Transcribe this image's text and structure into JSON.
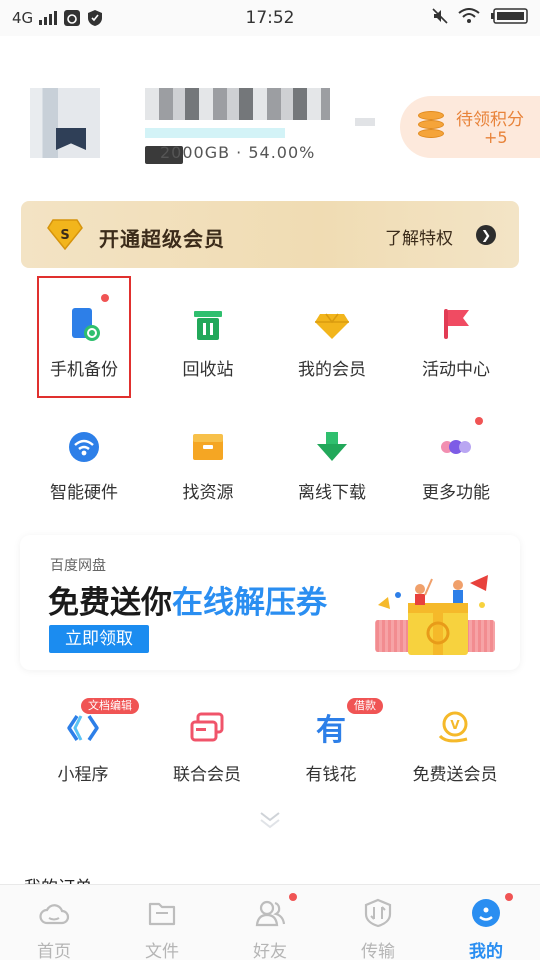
{
  "status_bar": {
    "network": "4G",
    "time": "17:52"
  },
  "profile": {
    "storage_text": "2000GB · 54.00%",
    "points_label": "待领积分",
    "points_value": "+5"
  },
  "vip_banner": {
    "title": "开通超级会员",
    "link": "了解特权"
  },
  "grid": [
    {
      "label": "手机备份",
      "icon": "phone-backup-icon",
      "dot": true
    },
    {
      "label": "回收站",
      "icon": "trash-bin-icon",
      "dot": false
    },
    {
      "label": "我的会员",
      "icon": "diamond-icon",
      "dot": false
    },
    {
      "label": "活动中心",
      "icon": "flag-icon",
      "dot": false
    },
    {
      "label": "智能硬件",
      "icon": "smart-hardware-icon",
      "dot": false
    },
    {
      "label": "找资源",
      "icon": "resource-box-icon",
      "dot": false
    },
    {
      "label": "离线下载",
      "icon": "download-arrow-icon",
      "dot": false
    },
    {
      "label": "更多功能",
      "icon": "more-dots-icon",
      "dot": true
    }
  ],
  "promo": {
    "small_title": "百度网盘",
    "headline_plain": "免费送你",
    "headline_highlight": "在线解压券",
    "button": "立即领取"
  },
  "tools": [
    {
      "label": "小程序",
      "icon": "mini-program-icon",
      "badge": "文档编辑"
    },
    {
      "label": "联合会员",
      "icon": "joint-member-icon",
      "badge": ""
    },
    {
      "label": "有钱花",
      "icon": "youqianhua-icon",
      "badge": "借款"
    },
    {
      "label": "免费送会员",
      "icon": "free-vip-icon",
      "badge": ""
    }
  ],
  "orders_label": "我的订单",
  "bottom_nav": [
    {
      "label": "首页",
      "icon": "cloud-home-icon",
      "active": false
    },
    {
      "label": "文件",
      "icon": "folder-icon",
      "active": false
    },
    {
      "label": "好友",
      "icon": "friends-icon",
      "active": false
    },
    {
      "label": "传输",
      "icon": "transfer-icon",
      "active": false
    },
    {
      "label": "我的",
      "icon": "profile-icon",
      "active": true
    }
  ],
  "colors": {
    "accent": "#2a8ef1",
    "badge": "#f05454",
    "highlight_box": "#e0302e",
    "points": "#e8833a"
  }
}
